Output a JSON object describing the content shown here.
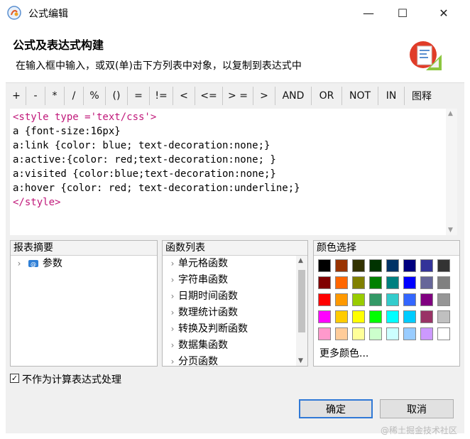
{
  "window": {
    "title": "公式编辑",
    "minimize": "—",
    "maximize": "☐",
    "close": "✕"
  },
  "header": {
    "title": "公式及表达式构建",
    "subtitle": "在输入框中输入，或双(单)击下方列表中对象，以复制到表达式中"
  },
  "operators": [
    "+",
    "-",
    "*",
    "/",
    "%",
    "()",
    "=",
    "!=",
    "<",
    "<=",
    "> =",
    ">",
    "AND",
    "OR",
    "NOT",
    "IN",
    "图释"
  ],
  "editor": {
    "lines": [
      "<style type ='text/css'>",
      "a {font-size:16px}",
      "a:link {color: blue; text-decoration:none;}",
      "a:active:{color: red;text-decoration:none; }",
      "a:visited {color:blue;text-decoration:none;}",
      "a:hover {color: red; text-decoration:underline;}",
      "</style>"
    ]
  },
  "summary_panel": {
    "title": "报表摘要",
    "items": [
      {
        "label": "参数",
        "icon": "param-icon"
      }
    ]
  },
  "function_panel": {
    "title": "函数列表",
    "items": [
      "单元格函数",
      "字符串函数",
      "日期时间函数",
      "数理统计函数",
      "转换及判断函数",
      "数据集函数",
      "分页函数"
    ]
  },
  "color_panel": {
    "title": "颜色选择",
    "more": "更多颜色...",
    "colors": [
      [
        "#000000",
        "#993300",
        "#333300",
        "#003300",
        "#003366",
        "#000080",
        "#333399",
        "#333333"
      ],
      [
        "#800000",
        "#FF6600",
        "#808000",
        "#008000",
        "#008080",
        "#0000FF",
        "#666699",
        "#808080"
      ],
      [
        "#FF0000",
        "#FF9900",
        "#99CC00",
        "#339966",
        "#33CCCC",
        "#3366FF",
        "#800080",
        "#969696"
      ],
      [
        "#FF00FF",
        "#FFCC00",
        "#FFFF00",
        "#00FF00",
        "#00FFFF",
        "#00CCFF",
        "#993366",
        "#C0C0C0"
      ],
      [
        "#FF99CC",
        "#FFCC99",
        "#FFFF99",
        "#CCFFCC",
        "#CCFFFF",
        "#99CCFF",
        "#CC99FF",
        "#FFFFFF"
      ]
    ]
  },
  "footer": {
    "checkbox_label": "不作为计算表达式处理",
    "checkbox_checked": true,
    "ok": "确定",
    "cancel": "取消",
    "watermark": "@稀土掘金技术社区"
  }
}
